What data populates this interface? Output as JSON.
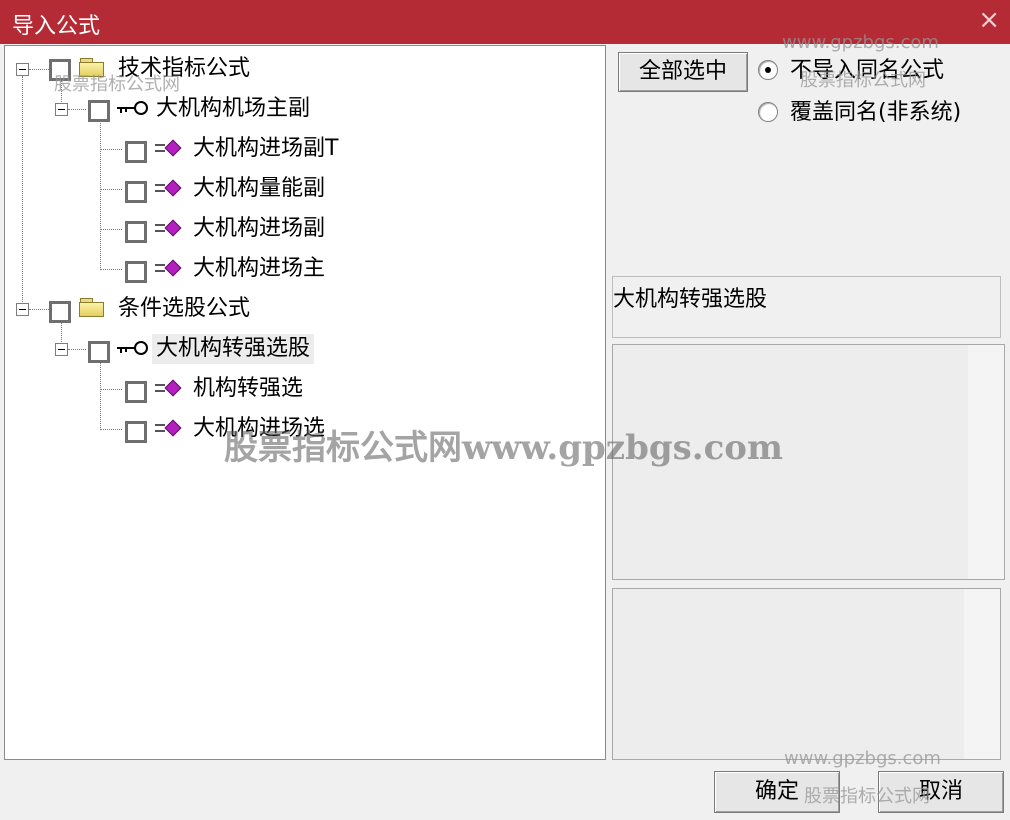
{
  "window": {
    "title": "导入公式",
    "close_icon": "×"
  },
  "tree": {
    "groups": [
      {
        "label": "技术指标公式",
        "formula": {
          "label": "大机构机场主副",
          "items": [
            "大机构进场副T",
            "大机构量能副",
            "大机构进场副",
            "大机构进场主"
          ]
        }
      },
      {
        "label": "条件选股公式",
        "formula": {
          "label": "大机构转强选股",
          "items": [
            "机构转强选",
            "大机构进场选"
          ]
        }
      }
    ]
  },
  "actions": {
    "select_all_label": "全部选中",
    "radio_skip_label": "不导入同名公式",
    "radio_overwrite_label": "覆盖同名(非系统)",
    "selected_radio": "skip"
  },
  "info": {
    "selected_name": "大机构转强选股"
  },
  "footer": {
    "ok_label": "确定",
    "cancel_label": "取消"
  },
  "watermarks": {
    "center": "股票指标公式网www.gpzbgs.com",
    "url": "www.gpzbgs.com",
    "site": "股票指标公式网"
  }
}
